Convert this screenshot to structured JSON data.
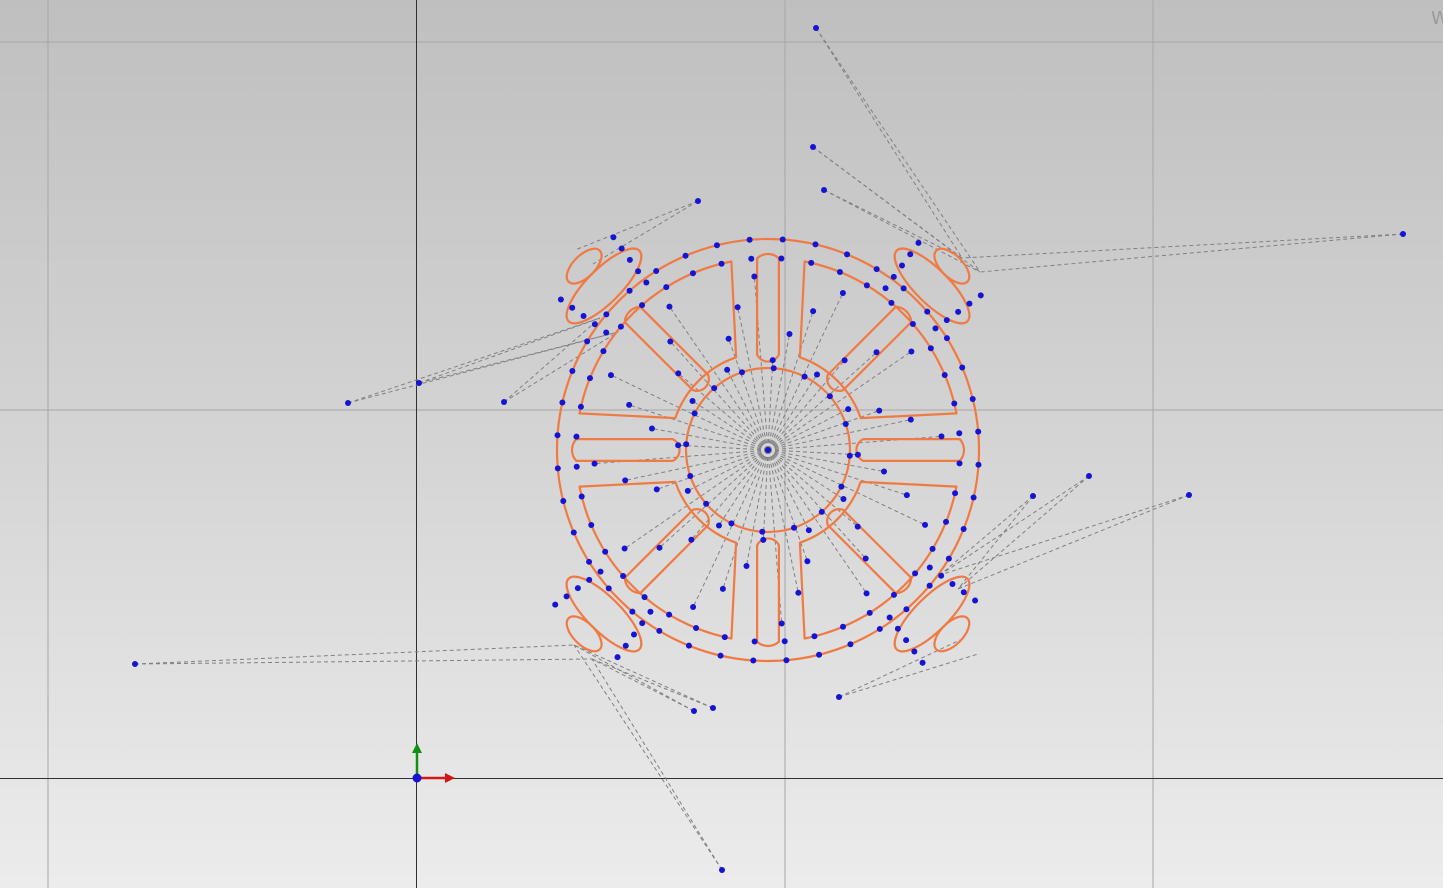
{
  "app": {
    "view_label": "W",
    "colors": {
      "grid": "#a6a6a6",
      "axis": "#303030",
      "sketch_curve": "#f07a44",
      "control_point": "#1414d2",
      "control_polygon": "#808080",
      "axis_x": "#d01818",
      "axis_y": "#109010",
      "origin": "#1414d2"
    }
  }
}
